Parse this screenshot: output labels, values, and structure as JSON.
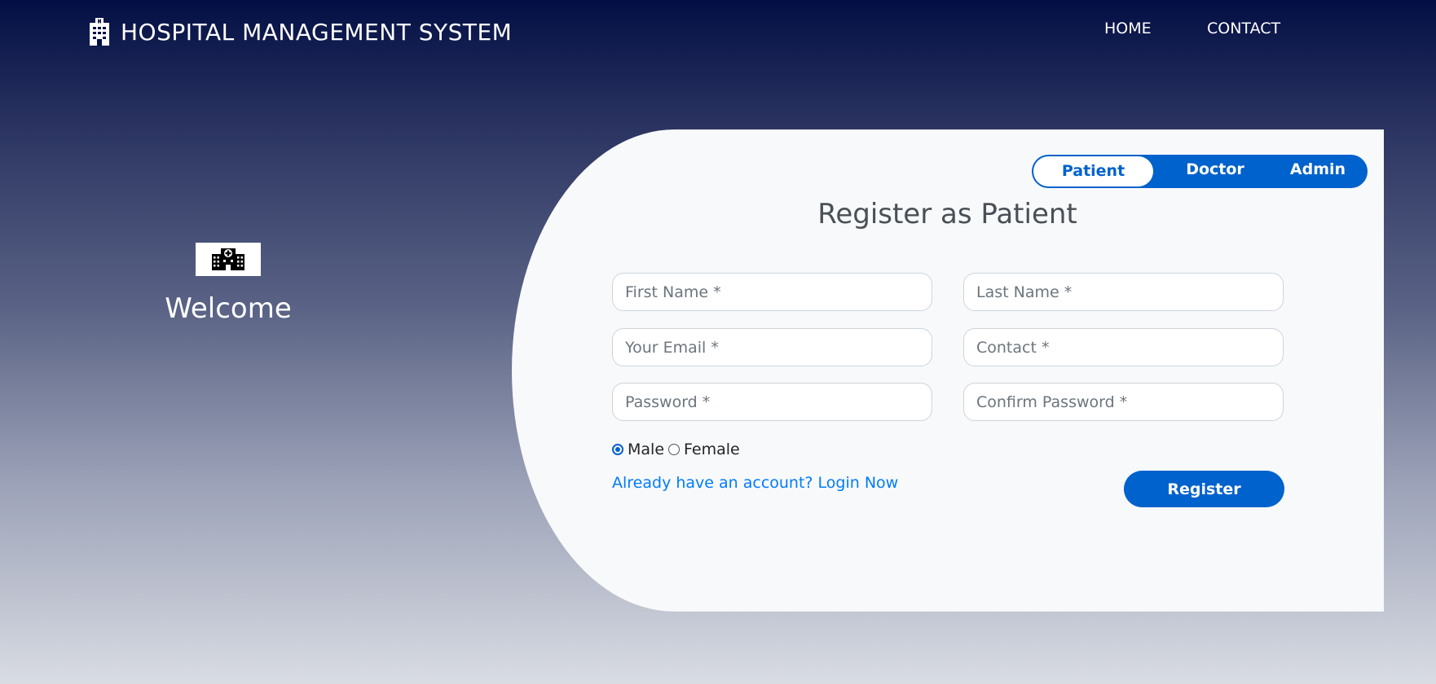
{
  "navbar": {
    "brand_icon": "hospital-building-icon",
    "brand_title": "HOSPITAL MANAGEMENT SYSTEM",
    "links": [
      "HOME",
      "CONTACT"
    ]
  },
  "left": {
    "logo_icon": "hospital-icon",
    "welcome": "Welcome"
  },
  "tabs": {
    "items": [
      "Patient",
      "Doctor",
      "Admin"
    ],
    "active": "Patient"
  },
  "form": {
    "title": "Register as Patient",
    "first_name_placeholder": "First Name *",
    "last_name_placeholder": "Last Name *",
    "email_placeholder": "Your Email *",
    "contact_placeholder": "Contact *",
    "password_placeholder": "Password *",
    "confirm_password_placeholder": "Confirm Password *",
    "gender_options": [
      "Male",
      "Female"
    ],
    "gender_selected": "Male",
    "login_link": "Already have an account? Login Now",
    "register_label": "Register"
  },
  "colors": {
    "accent": "#0062cc",
    "link": "#007bff",
    "card_bg": "#f8f9fa",
    "header_dark": "#030f44"
  }
}
